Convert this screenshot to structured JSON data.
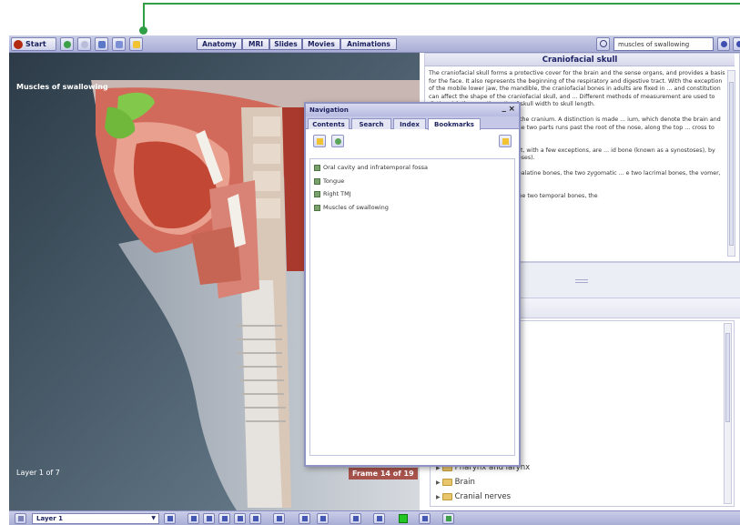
{
  "toolbar": {
    "start_label": "Start",
    "tabs": [
      "Anatomy",
      "MRI",
      "Slides",
      "Movies",
      "Animations"
    ],
    "search_value": "muscles of swallowing"
  },
  "viewer": {
    "title": "Muscles of swallowing",
    "layer_label": "Layer 1 of 7",
    "frame_label": "Frame 14 of 19"
  },
  "article": {
    "title": "Craniofacial skull",
    "paragraphs": [
      "The craniofacial skull forms a protective cover for the brain and the sense organs, and provides a basis for the face. It also represents the beginning of the respiratory and digestive tract. With the exception of the mobile lower jaw, the mandible, the craniofacial bones in adults are fixed in ... and constitution can affect the shape of the craniofacial skull, and ... Different methods of measurement are used to distinguish these ... the ratio of skull width to skull length.",
      "... subdivided into the face and the cranium. A distinction is made ... ium, which denote the brain and face parts of the skull ... en these two parts runs past the root of the nose, along the top ... cross to the external auditory canals.",
      "... posed of individual bones that, with a few exceptions, are ... id bone (known as a synostoses), by bone sutures, or by primary ... oses).",
      "... s: the two maxillae, the two palatine bones, the two zygomatic ... e two lacrimal bones, the vomer, the two inferior conchae and",
      "... t bones: the occipital bone, the two temporal bones, the"
    ]
  },
  "tree": {
    "items": [
      "Pharynx and larynx",
      "Brain",
      "Cranial nerves"
    ]
  },
  "navigation": {
    "title": "Navigation",
    "tabs": [
      "Contents",
      "Search",
      "Index",
      "Bookmarks"
    ],
    "active_tab": "Bookmarks",
    "bookmarks": [
      "Oral cavity and infratemporal fossa",
      "Tongue",
      "Right TMJ",
      "Muscles of swallowing"
    ]
  },
  "bottombar": {
    "layer_select": "Layer 1"
  },
  "colors": {
    "accent_green": "#2f9e44",
    "toolbar": "#b9bde0",
    "title_text": "#1d2266"
  }
}
